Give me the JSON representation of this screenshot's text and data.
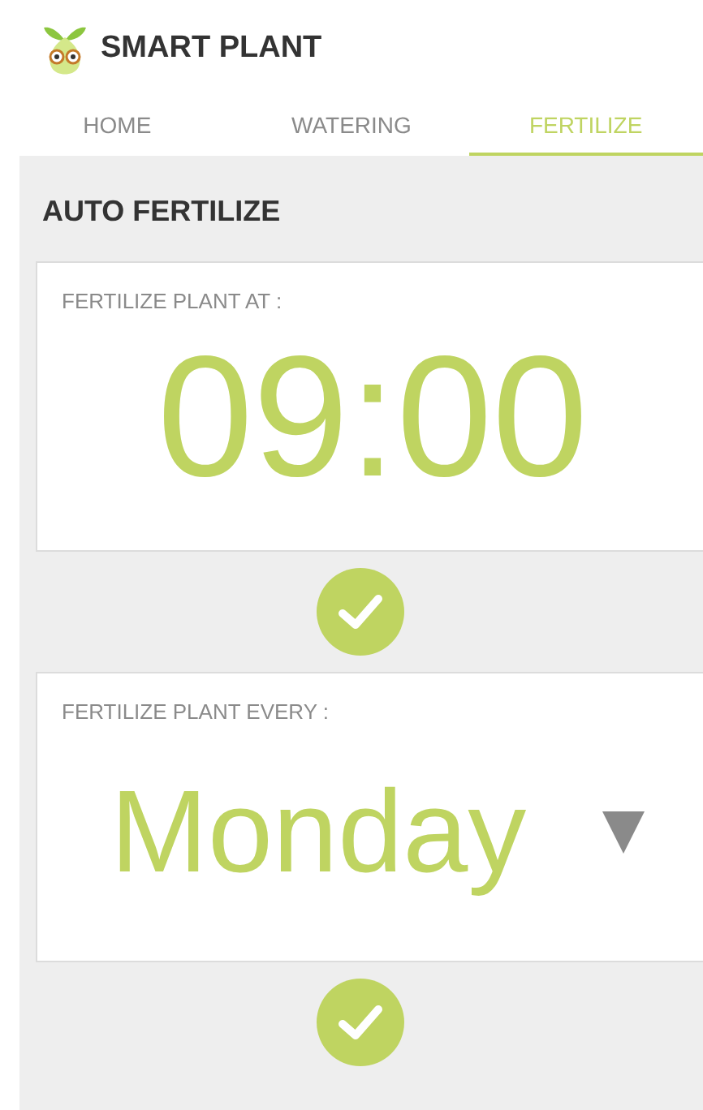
{
  "app": {
    "title": "SMART PLANT"
  },
  "tabs": [
    {
      "label": "HOME",
      "selected": false
    },
    {
      "label": "WATERING",
      "selected": false
    },
    {
      "label": "FERTILIZE",
      "selected": true
    }
  ],
  "section": {
    "title": "AUTO FERTILIZE"
  },
  "settings": [
    {
      "kind": "time",
      "label": "FERTILIZE PLANT AT :",
      "value": "09:00"
    },
    {
      "kind": "dropdown",
      "label": "FERTILIZE PLANT EVERY :",
      "value": "Monday"
    }
  ]
}
